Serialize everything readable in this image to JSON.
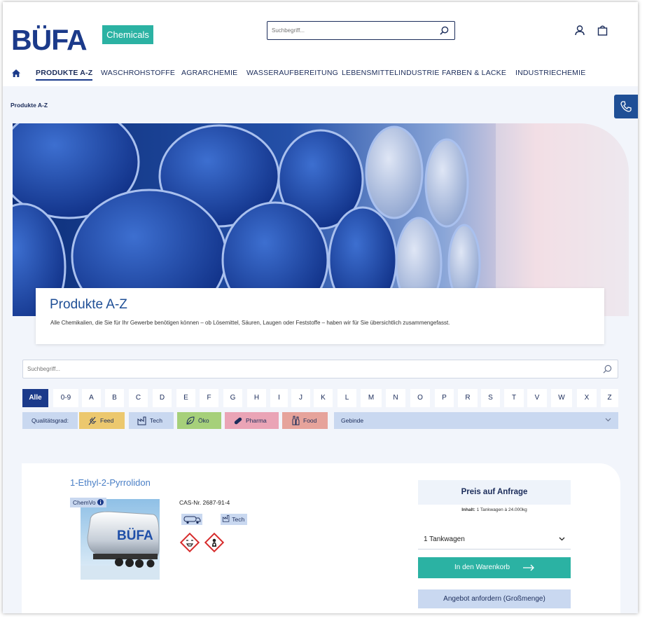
{
  "brand": {
    "logo_text": "BÜFA",
    "badge": "Chemicals"
  },
  "header": {
    "search_placeholder": "Suchbegriff..."
  },
  "nav": {
    "items": [
      "PRODUKTE A-Z",
      "WASCHROHSTOFFE",
      "AGRARCHEMIE",
      "WASSERAUFBEREITUNG",
      "LEBENSMITTELINDUSTRIE",
      "FARBEN & LACKE",
      "INDUSTRIECHEMIE"
    ],
    "active": "PRODUKTE A-Z"
  },
  "breadcrumb": "Produkte A-Z",
  "hero": {
    "title": "Produkte A-Z",
    "description": "Alle Chemikalien, die Sie für Ihr Gewerbe benötigen können – ob Lösemittel, Säuren, Laugen oder Feststoffe – haben wir für Sie übersichtlich zusammengefasst."
  },
  "filter": {
    "search_placeholder": "Suchbegriff...",
    "letters": [
      "Alle",
      "0-9",
      "A",
      "B",
      "C",
      "D",
      "E",
      "F",
      "G",
      "H",
      "I",
      "J",
      "K",
      "L",
      "M",
      "N",
      "O",
      "P",
      "R",
      "S",
      "T",
      "V",
      "W",
      "X",
      "Z"
    ],
    "active_letter": "Alle",
    "quality_label": "Qualitätsgrad:",
    "quality": [
      {
        "label": "Feed",
        "color": "#ecc86e",
        "icon": "wheat-icon"
      },
      {
        "label": "Tech",
        "color": "#c9d8f0",
        "icon": "factory-icon"
      },
      {
        "label": "Öko",
        "color": "#a6d07a",
        "icon": "leaf-icon"
      },
      {
        "label": "Pharma",
        "color": "#eaa4b6",
        "icon": "pill-icon"
      },
      {
        "label": "Food",
        "color": "#e6a39b",
        "icon": "bottle-icon"
      }
    ],
    "gebinde_label": "Gebinde"
  },
  "product": {
    "name": "1-Ethyl-2-Pyrrolidon",
    "chemvo": "ChemVo",
    "cas": "CAS-Nr. 2687-91-4",
    "tech_tag": "Tech",
    "price_label": "Preis auf Anfrage",
    "inhalt_label": "Inhalt:",
    "inhalt_value": "1 Tankwagen à 24.000kg",
    "quantity": "1 Tankwagen",
    "cart_button": "In den Warenkorb",
    "offer_button": "Angebot anfordern (Großmenge)",
    "tanker_text": "BÜFA"
  },
  "colors": {
    "brand_blue": "#1b3a8a",
    "teal": "#2bb2a3",
    "light_blue": "#c9d8f0",
    "text_blue": "#4a7fc6"
  }
}
